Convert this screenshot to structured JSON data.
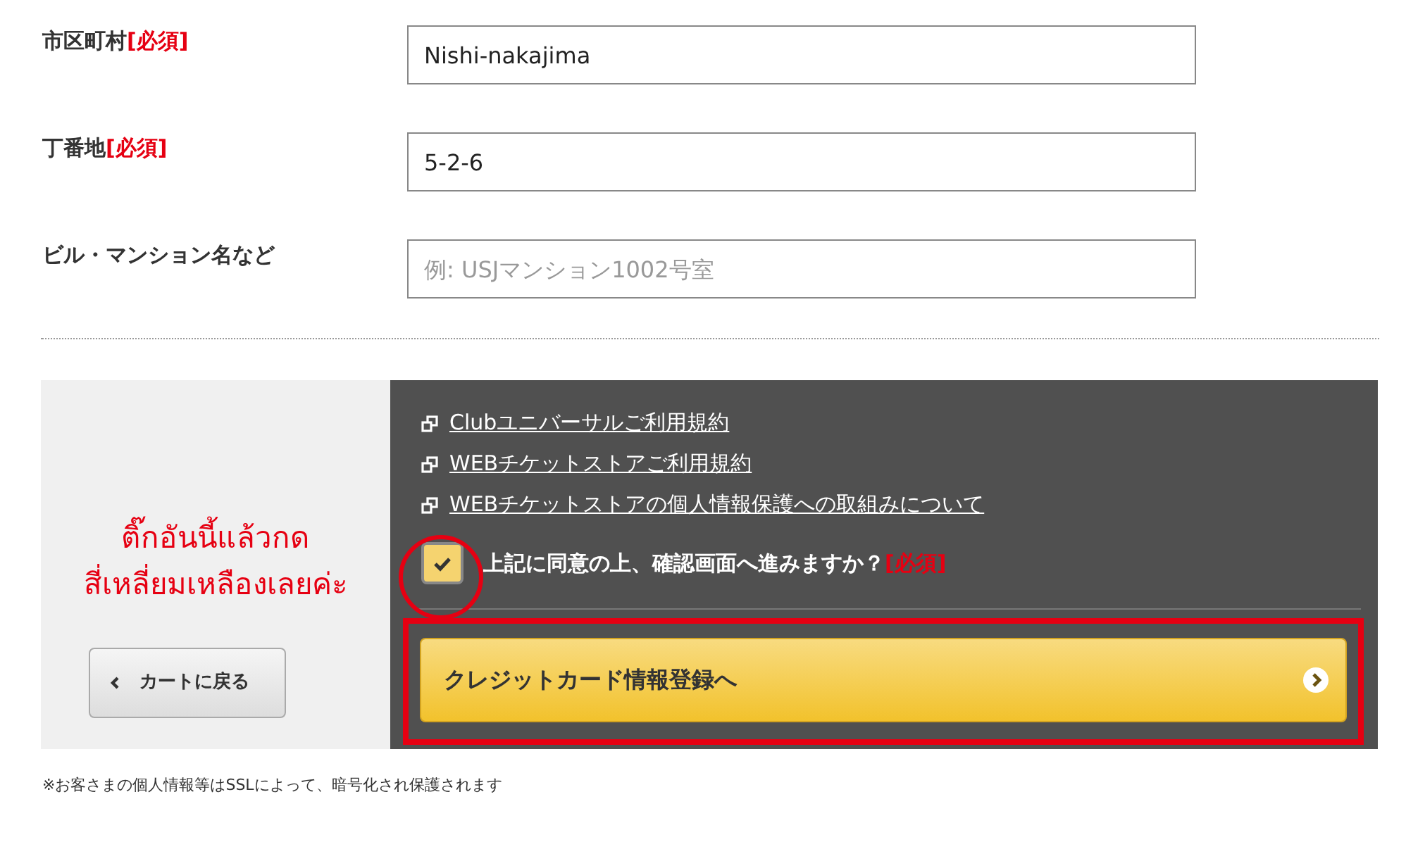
{
  "fields": [
    {
      "label": "市区町村",
      "required": "[必須]",
      "value": "Nishi-nakajima"
    },
    {
      "label": "丁番地",
      "required": "[必須]",
      "value": "5-2-6"
    },
    {
      "label": "ビル・マンション名など",
      "placeholder": "例: USJマンション1002号室"
    }
  ],
  "agreement": {
    "links": [
      "Clubユニバーサルご利用規約",
      "WEBチケットストアご利用規約",
      "WEBチケットストアの個人情報保護への取組みについて"
    ],
    "consent": {
      "label": "上記に同意の上、確認画面へ進みますか？",
      "required": "[必須]",
      "checked": true
    },
    "annotation": [
      "ติ๊กอันนี้แล้วกด",
      "สี่เหลี่ยมเหลืองเลยค่ะ"
    ],
    "back_button": "カートに戻る",
    "next_button": "クレジットカード情報登録へ"
  },
  "footnote": "※お客さまの個人情報等はSSLによって、暗号化され保護されます"
}
